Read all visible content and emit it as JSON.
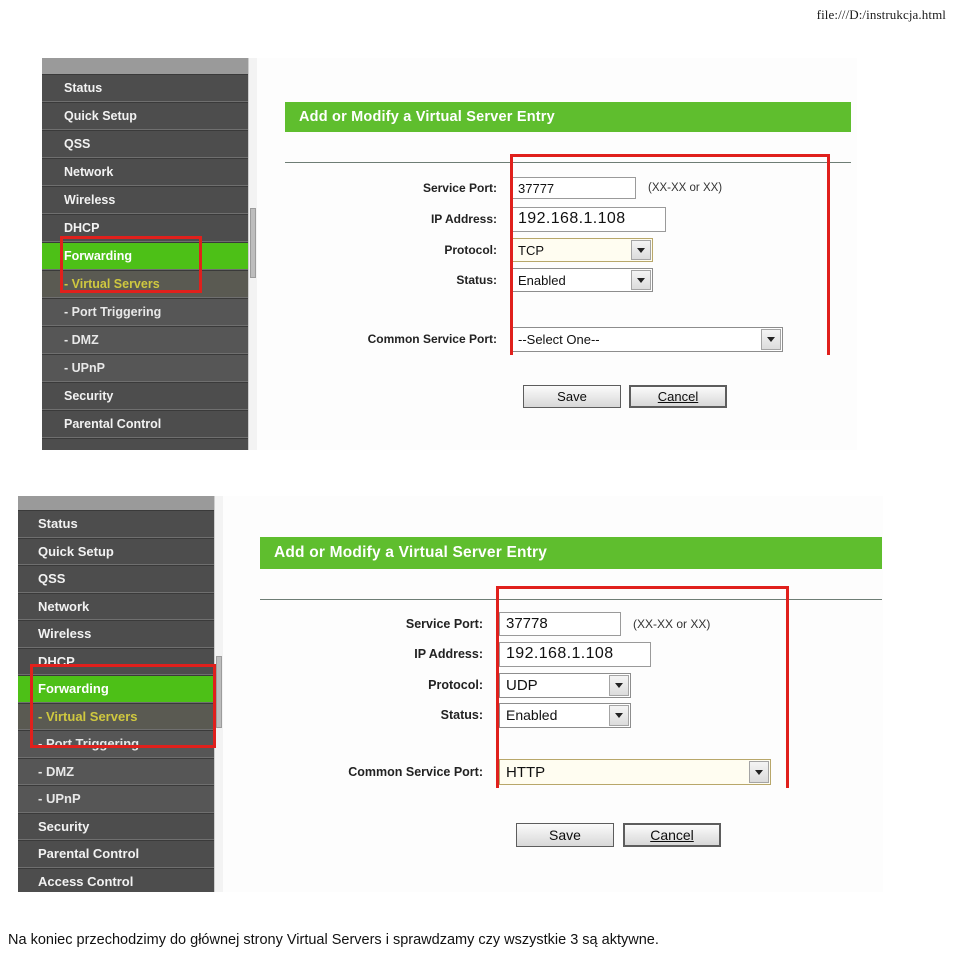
{
  "document": {
    "header_url": "file:///D:/instrukcja.html",
    "caption": "Na koniec przechodzimy do głównej strony Virtual Servers i sprawdzamy czy wszystkie 3 są aktywne."
  },
  "colors": {
    "green_bar": "#5fbe2e",
    "sidebar_active_green": "#4dc017",
    "annotation_red": "#e0201c",
    "sidebar_bg": "#4d4d4d"
  },
  "screenshot1": {
    "sidebar": {
      "items": [
        {
          "label": "Status",
          "state": "normal"
        },
        {
          "label": "Quick Setup",
          "state": "normal"
        },
        {
          "label": "QSS",
          "state": "normal"
        },
        {
          "label": "Network",
          "state": "normal"
        },
        {
          "label": "Wireless",
          "state": "normal"
        },
        {
          "label": "DHCP",
          "state": "normal"
        },
        {
          "label": "Forwarding",
          "state": "active"
        },
        {
          "label": "- Virtual Servers",
          "state": "active-sub"
        },
        {
          "label": "- Port Triggering",
          "state": "sub"
        },
        {
          "label": "- DMZ",
          "state": "sub"
        },
        {
          "label": "- UPnP",
          "state": "sub"
        },
        {
          "label": "Security",
          "state": "normal"
        },
        {
          "label": "Parental Control",
          "state": "normal"
        },
        {
          "label": "",
          "state": "normal"
        }
      ]
    },
    "panel": {
      "title": "Add or Modify a Virtual Server Entry",
      "fields": {
        "service_port_label": "Service Port:",
        "service_port_value": "37777",
        "service_port_hint": "(XX-XX or XX)",
        "ip_address_label": "IP Address:",
        "ip_address_value": "192.168.1.108",
        "protocol_label": "Protocol:",
        "protocol_value": "TCP",
        "status_label": "Status:",
        "status_value": "Enabled",
        "common_service_port_label": "Common Service Port:",
        "common_service_port_value": "--Select One--"
      },
      "buttons": {
        "save": "Save",
        "cancel": "Cancel"
      }
    }
  },
  "screenshot2": {
    "sidebar": {
      "items": [
        {
          "label": "Status",
          "state": "normal"
        },
        {
          "label": "Quick Setup",
          "state": "normal"
        },
        {
          "label": "QSS",
          "state": "normal"
        },
        {
          "label": "Network",
          "state": "normal"
        },
        {
          "label": "Wireless",
          "state": "normal"
        },
        {
          "label": "DHCP",
          "state": "normal"
        },
        {
          "label": "Forwarding",
          "state": "active"
        },
        {
          "label": "- Virtual Servers",
          "state": "active-sub"
        },
        {
          "label": "- Port Triggering",
          "state": "sub"
        },
        {
          "label": "- DMZ",
          "state": "sub"
        },
        {
          "label": "- UPnP",
          "state": "sub"
        },
        {
          "label": "Security",
          "state": "normal"
        },
        {
          "label": "Parental Control",
          "state": "normal"
        },
        {
          "label": "Access Control",
          "state": "normal"
        }
      ]
    },
    "panel": {
      "title": "Add or Modify a Virtual Server Entry",
      "fields": {
        "service_port_label": "Service Port:",
        "service_port_value": "37778",
        "service_port_hint": "(XX-XX or XX)",
        "ip_address_label": "IP Address:",
        "ip_address_value": "192.168.1.108",
        "protocol_label": "Protocol:",
        "protocol_value": "UDP",
        "status_label": "Status:",
        "status_value": "Enabled",
        "common_service_port_label": "Common Service Port:",
        "common_service_port_value": "HTTP"
      },
      "buttons": {
        "save": "Save",
        "cancel": "Cancel"
      }
    }
  }
}
